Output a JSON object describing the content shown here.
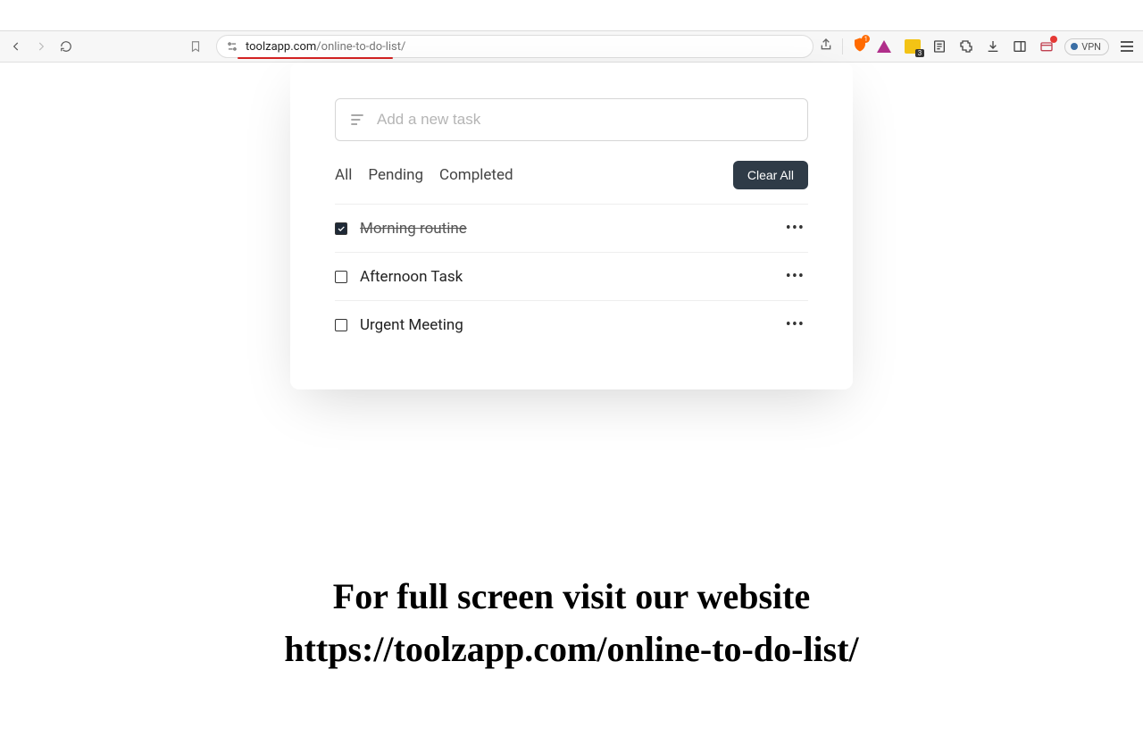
{
  "browser": {
    "url_host": "toolzapp.com",
    "url_path": "/online-to-do-list/",
    "note_badge": "3",
    "shield_badge": "1",
    "vpn_label": "VPN"
  },
  "todo": {
    "input_placeholder": "Add a new task",
    "filters": {
      "all": "All",
      "pending": "Pending",
      "completed": "Completed"
    },
    "clear_label": "Clear All",
    "tasks": [
      {
        "label": "Morning routine",
        "completed": true
      },
      {
        "label": "Afternoon Task",
        "completed": false
      },
      {
        "label": "Urgent Meeting",
        "completed": false
      }
    ]
  },
  "footer": {
    "line1": "For full screen visit our website",
    "line2": "https://toolzapp.com/online-to-do-list/"
  }
}
